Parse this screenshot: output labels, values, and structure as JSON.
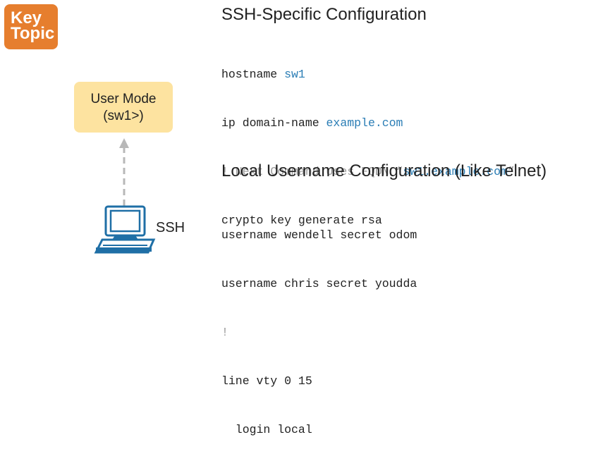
{
  "badge": {
    "line1": "Key",
    "line2": "Topic"
  },
  "user_mode": {
    "line1": "User Mode",
    "line2": "(sw1>)"
  },
  "ssh_label": "SSH",
  "colors": {
    "accent_blue": "#2a7db5",
    "badge_orange": "#e67e2e",
    "box_yellow": "#fde3a0",
    "comment_gray": "#9a9a9a"
  },
  "ssh_config": {
    "title": "SSH-Specific Configuration",
    "line1_cmd": "hostname ",
    "line1_arg": "sw1",
    "line2_cmd": "ip domain-name ",
    "line2_arg": "example.com",
    "line3_comment": "! Next Command Uses FQDN “",
    "line3_arg": "sw1.example.com",
    "line3_end": "”",
    "line4": "crypto key generate rsa"
  },
  "local_config": {
    "title": "Local Username Configuration (Like Telnet)",
    "lines": [
      "username wendell secret odom",
      "username chris secret youdda",
      "!",
      "line vty 0 15",
      "  login local"
    ]
  }
}
